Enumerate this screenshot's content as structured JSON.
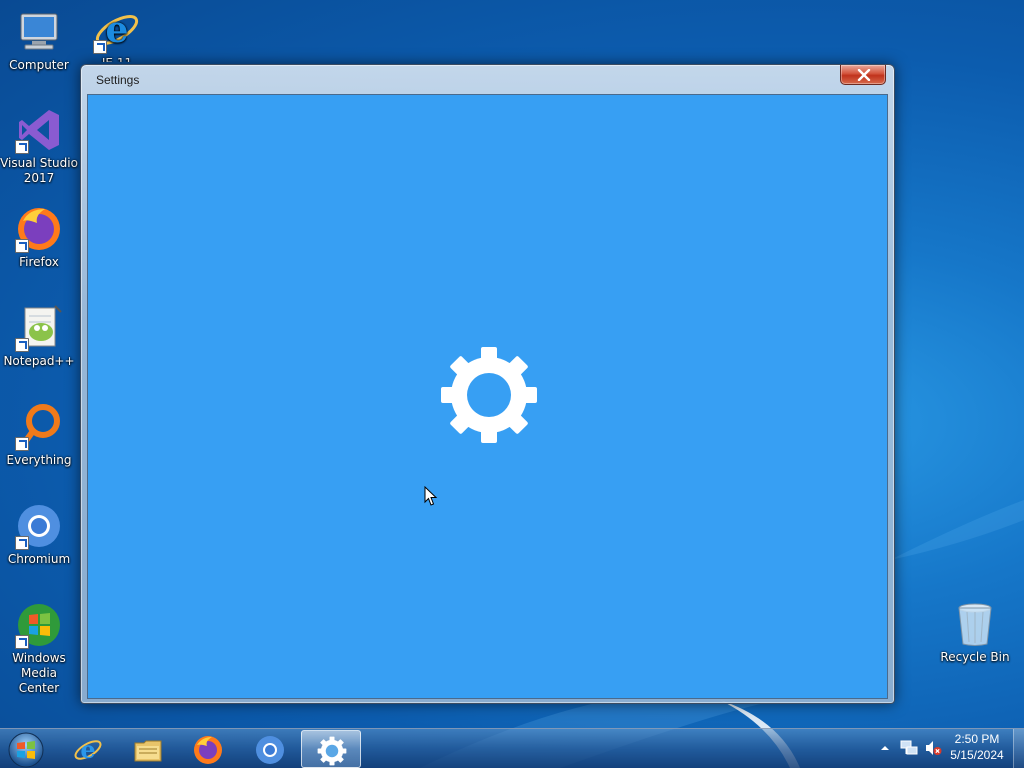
{
  "desktop": {
    "icons": [
      {
        "label": "Computer",
        "icon": "computer-icon"
      },
      {
        "label": "IE 11",
        "icon": "internet-explorer-icon"
      },
      {
        "label": "Visual Studio 2017",
        "icon": "visual-studio-icon"
      },
      {
        "label": "Firefox",
        "icon": "firefox-icon"
      },
      {
        "label": "Notepad++",
        "icon": "notepad-plus-plus-icon"
      },
      {
        "label": "Everything",
        "icon": "everything-icon"
      },
      {
        "label": "Chromium",
        "icon": "chromium-icon"
      },
      {
        "label": "Windows Media Center",
        "icon": "windows-media-center-icon"
      },
      {
        "label": "Recycle Bin",
        "icon": "recycle-bin-icon"
      }
    ]
  },
  "window": {
    "title": "Settings",
    "client_color": "#379ff3",
    "center_icon": "gear-icon"
  },
  "taskbar": {
    "pinned": [
      {
        "name": "Internet Explorer",
        "icon": "internet-explorer-icon"
      },
      {
        "name": "Windows Explorer",
        "icon": "folder-icon"
      },
      {
        "name": "Firefox",
        "icon": "firefox-icon"
      },
      {
        "name": "Chromium",
        "icon": "chromium-icon"
      },
      {
        "name": "Settings",
        "icon": "gear-icon",
        "active": true
      }
    ],
    "clock": {
      "time": "2:50 PM",
      "date": "5/15/2024"
    }
  }
}
